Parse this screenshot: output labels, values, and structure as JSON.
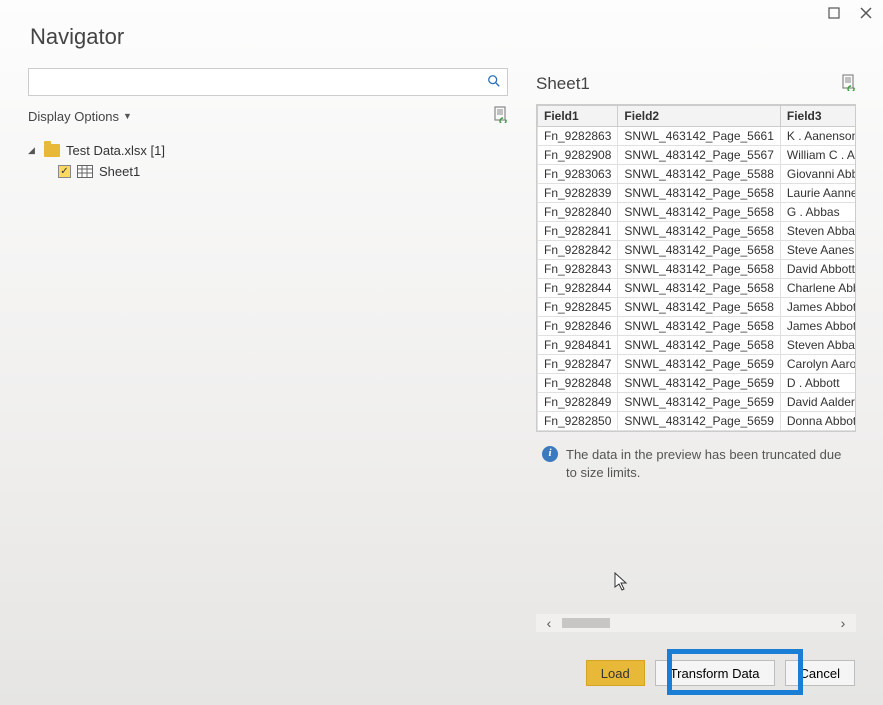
{
  "window": {
    "title": "Navigator"
  },
  "left": {
    "display_options_label": "Display Options",
    "tree": {
      "file_label": "Test Data.xlsx [1]",
      "sheet_label": "Sheet1"
    }
  },
  "right": {
    "sheet_title": "Sheet1",
    "columns": [
      "Field1",
      "Field2",
      "Field3"
    ],
    "rows": [
      [
        "Fn_9282863",
        "SNWL_463142_Page_5661",
        "K . Aanenson"
      ],
      [
        "Fn_9282908",
        "SNWL_483142_Page_5567",
        "William C . Aar"
      ],
      [
        "Fn_9283063",
        "SNWL_483142_Page_5588",
        "Giovanni Abbo"
      ],
      [
        "Fn_9282839",
        "SNWL_483142_Page_5658",
        "Laurie Aanner"
      ],
      [
        "Fn_9282840",
        "SNWL_483142_Page_5658",
        "G . Abbas"
      ],
      [
        "Fn_9282841",
        "SNWL_483142_Page_5658",
        "Steven Abbas"
      ],
      [
        "Fn_9282842",
        "SNWL_483142_Page_5658",
        "Steve Aanes"
      ],
      [
        "Fn_9282843",
        "SNWL_483142_Page_5658",
        "David Abbott"
      ],
      [
        "Fn_9282844",
        "SNWL_483142_Page_5658",
        "Charlene Abbo"
      ],
      [
        "Fn_9282845",
        "SNWL_483142_Page_5658",
        "James Abbott"
      ],
      [
        "Fn_9282846",
        "SNWL_483142_Page_5658",
        "James Abbott"
      ],
      [
        "Fn_9284841",
        "SNWL_483142_Page_5658",
        "Steven Abbas"
      ],
      [
        "Fn_9282847",
        "SNWL_483142_Page_5659",
        "Carolyn Aaron"
      ],
      [
        "Fn_9282848",
        "SNWL_483142_Page_5659",
        "D . Abbott"
      ],
      [
        "Fn_9282849",
        "SNWL_483142_Page_5659",
        "David Aalders"
      ],
      [
        "Fn_9282850",
        "SNWL_483142_Page_5659",
        "Donna Abbott"
      ]
    ],
    "info_text": "The data in the preview has been truncated due to size limits."
  },
  "buttons": {
    "load": "Load",
    "transform": "Transform Data",
    "cancel": "Cancel"
  }
}
